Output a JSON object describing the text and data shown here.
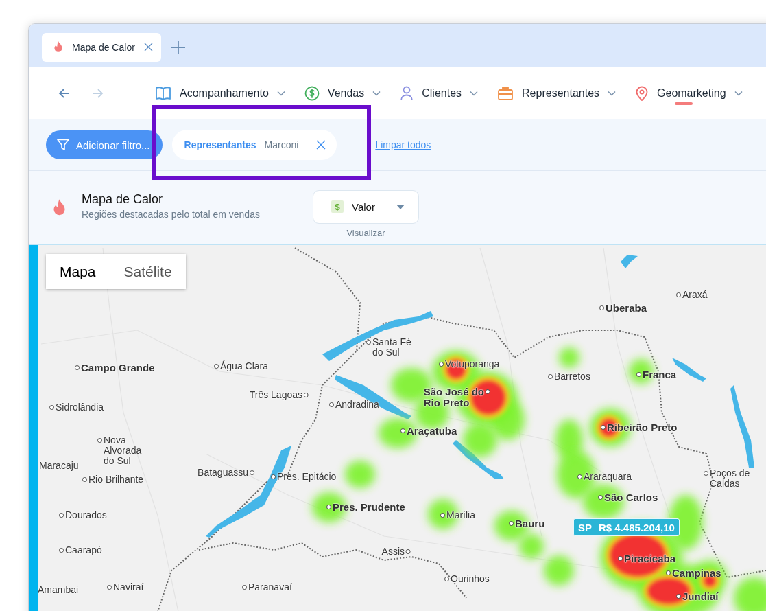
{
  "browser_tab": {
    "title": "Mapa de Calor"
  },
  "navigation": {
    "back_disabled": false,
    "forward_disabled": true,
    "menu": [
      {
        "label": "Acompanhamento",
        "selected": false
      },
      {
        "label": "Vendas",
        "selected": false
      },
      {
        "label": "Clientes",
        "selected": false
      },
      {
        "label": "Representantes",
        "selected": false
      },
      {
        "label": "Geomarketing",
        "selected": true
      }
    ]
  },
  "filters": {
    "add_button": "Adicionar filtro...",
    "chips": [
      {
        "field": "Representantes",
        "value": "Marconi"
      }
    ],
    "clear_link": "Limpar todos"
  },
  "header": {
    "title": "Mapa de Calor",
    "subtitle": "Regiões destacadas pelo total em vendas",
    "metric_select": {
      "icon": "$",
      "value": "Valor",
      "caption": "Visualizar"
    }
  },
  "map": {
    "view_toggle": [
      {
        "label": "Mapa",
        "selected": true
      },
      {
        "label": "Satélite",
        "selected": false
      }
    ],
    "places": [
      {
        "name": "Uberaba",
        "major": true
      },
      {
        "name": "Araxá",
        "major": false
      },
      {
        "name": "Santa Fé\ndo Sul",
        "major": false
      },
      {
        "name": "Campo Grande",
        "major": true
      },
      {
        "name": "Água Clara",
        "major": false
      },
      {
        "name": "Votuporanga",
        "major": false
      },
      {
        "name": "Barretos",
        "major": false
      },
      {
        "name": "Franca",
        "major": true
      },
      {
        "name": "Sidrolândia",
        "major": false
      },
      {
        "name": "Três Lagoas",
        "major": false
      },
      {
        "name": "Andradina",
        "major": false
      },
      {
        "name": "São José do\nRio Preto",
        "major": true
      },
      {
        "name": "Nova\nAlvorada\ndo Sul",
        "major": false
      },
      {
        "name": "Araçatuba",
        "major": true
      },
      {
        "name": "Ribeirão Preto",
        "major": true
      },
      {
        "name": "Maracaju",
        "major": false
      },
      {
        "name": "Rio Brilhante",
        "major": false
      },
      {
        "name": "Bataguassu",
        "major": false
      },
      {
        "name": "Pres. Epitácio",
        "major": false
      },
      {
        "name": "Araraquara",
        "major": false
      },
      {
        "name": "Poços de\nCaldas",
        "major": false
      },
      {
        "name": "Dourados",
        "major": false
      },
      {
        "name": "Pres. Prudente",
        "major": true
      },
      {
        "name": "Marília",
        "major": false
      },
      {
        "name": "Bauru",
        "major": true
      },
      {
        "name": "São Carlos",
        "major": true
      },
      {
        "name": "Caarapó",
        "major": false
      },
      {
        "name": "Assis",
        "major": false
      },
      {
        "name": "Piracicaba",
        "major": true
      },
      {
        "name": "Amambai",
        "major": false
      },
      {
        "name": "Naviraí",
        "major": false
      },
      {
        "name": "Paranavaí",
        "major": false
      },
      {
        "name": "Ourinhos",
        "major": false
      },
      {
        "name": "Campinas",
        "major": true
      },
      {
        "name": "Jundiaí",
        "major": true
      }
    ],
    "tooltip": {
      "region": "SP",
      "value": "R$ 4.485.204,10"
    }
  },
  "annotation": {
    "highlight_frame": true
  }
}
